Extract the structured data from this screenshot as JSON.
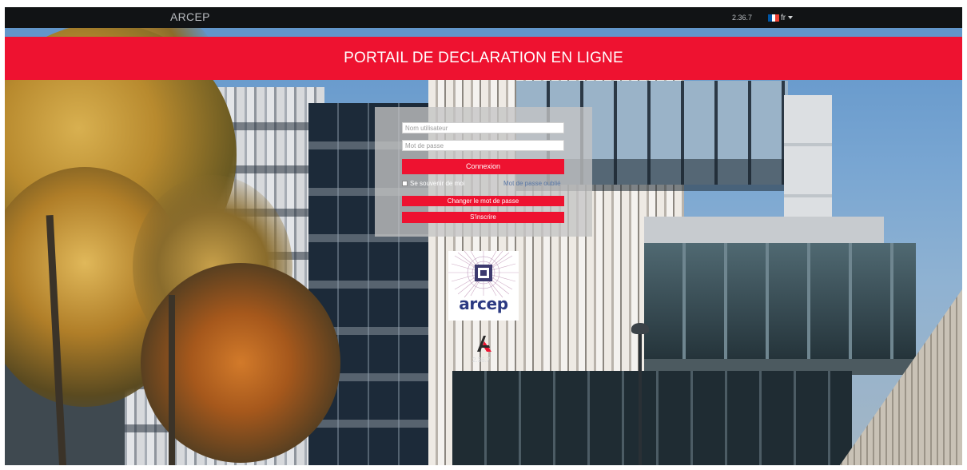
{
  "topbar": {
    "brand": "ARCEP",
    "version": "2.36.7",
    "language": {
      "label": "fr",
      "flag_colors": [
        "#0055a4",
        "#ffffff",
        "#ef4135"
      ]
    }
  },
  "banner": {
    "title": "PORTAIL DE DECLARATION EN LIGNE",
    "color": "#ee1230"
  },
  "login": {
    "username_placeholder": "Nom utilisateur",
    "username_value": "",
    "password_placeholder": "Mot de passe",
    "password_value": "",
    "login_button": "Connexion",
    "remember_label": "Se souvenir de moi",
    "remember_checked": false,
    "forgot_link": "Mot de passe oublié",
    "change_password_button": "Changer le mot de passe",
    "signup_button": "S'inscrire"
  },
  "logo": {
    "text": "arcep",
    "brand_color": "#2c3a82"
  },
  "footer": {
    "version": "2.36.7"
  },
  "icons": [
    "arcep-logo",
    "app-mark-icon",
    "french-flag-icon",
    "chevron-down-icon"
  ]
}
